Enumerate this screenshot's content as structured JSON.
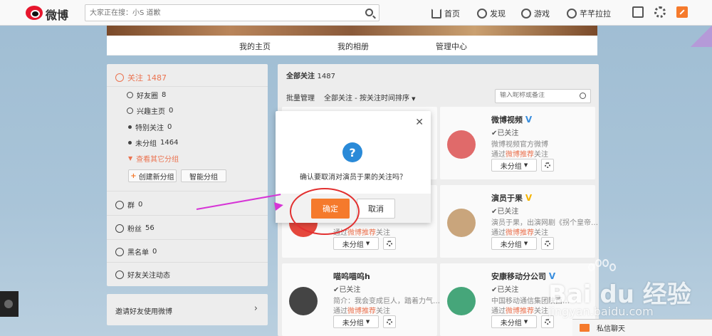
{
  "topbar": {
    "logo_text": "微博",
    "search_placeholder": "大家正在搜：小S 道歉",
    "nav": {
      "home": "首页",
      "discover": "发现",
      "game": "游戏",
      "user": "芊芊拉拉"
    }
  },
  "profile_nav": {
    "home": "我的主页",
    "album": "我的相册",
    "manage": "管理中心"
  },
  "left": {
    "follow_label": "关注",
    "follow_count": "1487",
    "items": [
      {
        "label": "好友圈",
        "count": "8"
      },
      {
        "label": "兴趣主页",
        "count": "0"
      },
      {
        "label": "特别关注",
        "count": "0"
      },
      {
        "label": "未分组",
        "count": "1464"
      }
    ],
    "more_groups": "查看其它分组",
    "create_group": "创建新分组",
    "smart_group": "智能分组",
    "group_label": "群",
    "group_count": "0",
    "fans_label": "粉丝",
    "fans_count": "56",
    "blacklist_label": "黑名单",
    "blacklist_count": "0",
    "friend_activity": "好友关注动态",
    "invite": "邀请好友使用微博"
  },
  "main": {
    "title": "全部关注",
    "count": "1487",
    "batch": "批量管理",
    "sort": "全部关注 - 按关注时间排序",
    "search_placeholder": "输入昵称或备注",
    "cards": [
      {
        "name": "微博视频",
        "verified": "V",
        "status": "✔已关注",
        "desc": "微博视频官方微博",
        "via_prefix": "通过",
        "via_link": "微博推荐",
        "via_suffix": "关注",
        "group": "未分组",
        "avatar_color": "#e06a6a"
      },
      {
        "name": "演员于果",
        "verified": "V",
        "status": "✔已关注",
        "desc": "演员于果，出演网剧《拐个皇帝…",
        "via_prefix": "通过",
        "via_link": "微博推荐",
        "via_suffix": "关注",
        "group": "未分组",
        "avatar_color": "#c9a57c"
      },
      {
        "name": "喵呜喵呜h",
        "verified": "",
        "status": "✔已关注",
        "desc": "简介：我会变成巨人，踏着力气…",
        "via_prefix": "通过",
        "via_link": "微博推荐",
        "via_suffix": "关注",
        "group": "未分组",
        "avatar_color": "#444"
      },
      {
        "name": "安康移动分公司",
        "verified": "V",
        "status": "✔已关注",
        "desc": "中国移动通信集团陕西…",
        "via_prefix": "通过",
        "via_link": "微博推荐",
        "via_suffix": "关注",
        "group": "未分组",
        "avatar_color": "#46a67a"
      },
      {
        "name": "",
        "verified": "",
        "status": "",
        "desc": "",
        "via_prefix": "通过",
        "via_link": "微博推荐",
        "via_suffix": "关注",
        "group": "未分组",
        "avatar_color": "#e5473c"
      }
    ]
  },
  "dialog": {
    "message": "确认要取消对演员于果的关注吗？",
    "confirm": "确定",
    "cancel": "取消",
    "icon": "?"
  },
  "chat": {
    "label": "私信聊天"
  },
  "watermark": {
    "text": "Bai du 经验",
    "url": "jingyan.baidu.com"
  },
  "colors": {
    "accent": "#f57a2c",
    "link": "#eb7350",
    "annotation": "#d634d6",
    "circle": "#e23030"
  }
}
